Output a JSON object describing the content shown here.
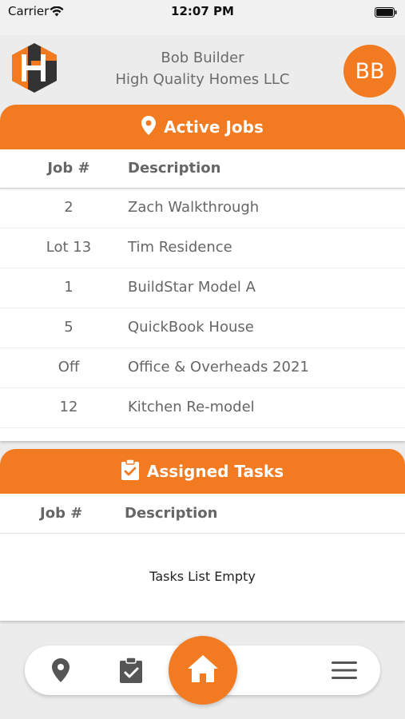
{
  "status_bar": {
    "carrier": "Carrier",
    "time": "12:07 PM"
  },
  "header": {
    "user_name": "Bob Builder",
    "company": "High Quality Homes LLC",
    "avatar_initials": "BB"
  },
  "active_jobs": {
    "title": "Active Jobs",
    "columns": {
      "job": "Job #",
      "description": "Description"
    },
    "rows": [
      {
        "job": "2",
        "description": "Zach Walkthrough"
      },
      {
        "job": "Lot 13",
        "description": "Tim Residence"
      },
      {
        "job": "1",
        "description": "BuildStar Model A"
      },
      {
        "job": "5",
        "description": "QuickBook House"
      },
      {
        "job": "Off",
        "description": "Office & Overheads 2021"
      },
      {
        "job": "12",
        "description": "Kitchen Re-model"
      }
    ]
  },
  "assigned_tasks": {
    "title": "Assigned Tasks",
    "columns": {
      "job": "Job #",
      "description": "Description"
    },
    "empty_text": "Tasks List Empty"
  },
  "nav": {
    "items": [
      "map-pin-icon",
      "clipboard-check-icon",
      "home-icon",
      "hamburger-menu-icon"
    ]
  },
  "colors": {
    "accent": "#f27a21",
    "text": "#666666",
    "background": "#ececec"
  }
}
